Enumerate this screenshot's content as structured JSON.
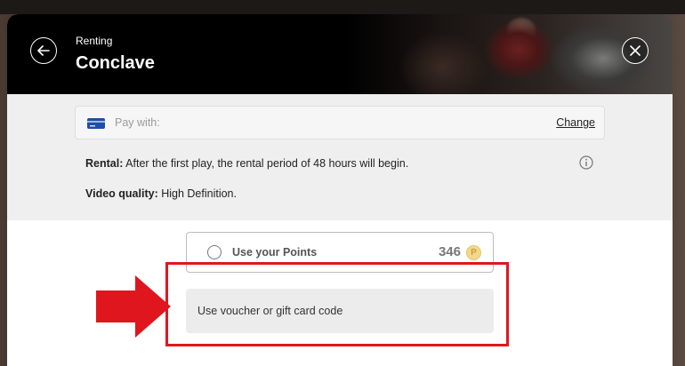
{
  "header": {
    "eyebrow": "Renting",
    "title": "Conclave"
  },
  "payment": {
    "label": "Pay with:",
    "change_label": "Change"
  },
  "rental_info": {
    "rental_label": "Rental:",
    "rental_text": "After the first play, the rental period of 48 hours will begin.",
    "quality_label": "Video quality:",
    "quality_text": "High Definition."
  },
  "points": {
    "label": "Use your Points",
    "value": "346"
  },
  "voucher": {
    "label": "Use voucher or gift card code"
  },
  "colors": {
    "header_bg": "#000000",
    "highlight_red": "#e0161e",
    "card_blue": "#1d4fa8"
  },
  "icons": [
    "back-arrow-icon",
    "close-icon",
    "credit-card-icon",
    "info-icon",
    "coin-icon",
    "pointer-arrow-icon"
  ]
}
